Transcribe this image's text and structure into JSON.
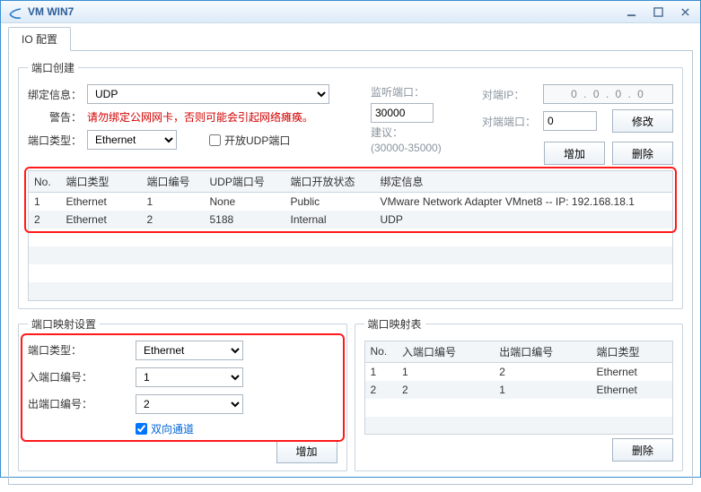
{
  "window": {
    "title": "VM WIN7"
  },
  "tabs": {
    "io_config": "IO 配置"
  },
  "port_create": {
    "legend": "端口创建",
    "bind_info_label": "绑定信息：",
    "bind_info_value": "UDP",
    "warning_label": "警告：",
    "warning_text": "请勿绑定公网网卡，否则可能会引起网络瘫痪。",
    "port_type_label": "端口类型：",
    "port_type_value": "Ethernet",
    "open_udp_label": "开放UDP端口",
    "listen_port_label": "监听端口：",
    "listen_port_value": "30000",
    "listen_port_hint_label": "建议：",
    "listen_port_hint_value": "(30000-35000)",
    "peer_ip_label": "对端IP：",
    "peer_ip_value": "0  .  0  .  0  .  0",
    "peer_port_label": "对端端口：",
    "peer_port_value": "0",
    "btn_modify": "修改",
    "btn_add": "增加",
    "btn_delete": "删除",
    "table": {
      "headers": {
        "no": "No.",
        "type": "端口类型",
        "num": "端口编号",
        "udp": "UDP端口号",
        "open": "端口开放状态",
        "bind": "绑定信息"
      },
      "rows": [
        {
          "no": "1",
          "type": "Ethernet",
          "num": "1",
          "udp": "None",
          "open": "Public",
          "bind": "VMware Network Adapter VMnet8 -- IP: 192.168.18.1"
        },
        {
          "no": "2",
          "type": "Ethernet",
          "num": "2",
          "udp": "5188",
          "open": "Internal",
          "bind": "UDP"
        }
      ]
    }
  },
  "mapping_settings": {
    "legend": "端口映射设置",
    "port_type_label": "端口类型：",
    "port_type_value": "Ethernet",
    "in_port_label": "入端口编号：",
    "in_port_value": "1",
    "out_port_label": "出端口编号：",
    "out_port_value": "2",
    "bidir_label": "双向通道",
    "btn_add": "增加"
  },
  "mapping_table": {
    "legend": "端口映射表",
    "headers": {
      "no": "No.",
      "in": "入端口编号",
      "out": "出端口编号",
      "type": "端口类型"
    },
    "rows": [
      {
        "no": "1",
        "in": "1",
        "out": "2",
        "type": "Ethernet"
      },
      {
        "no": "2",
        "in": "2",
        "out": "1",
        "type": "Ethernet"
      }
    ],
    "btn_delete": "删除"
  }
}
